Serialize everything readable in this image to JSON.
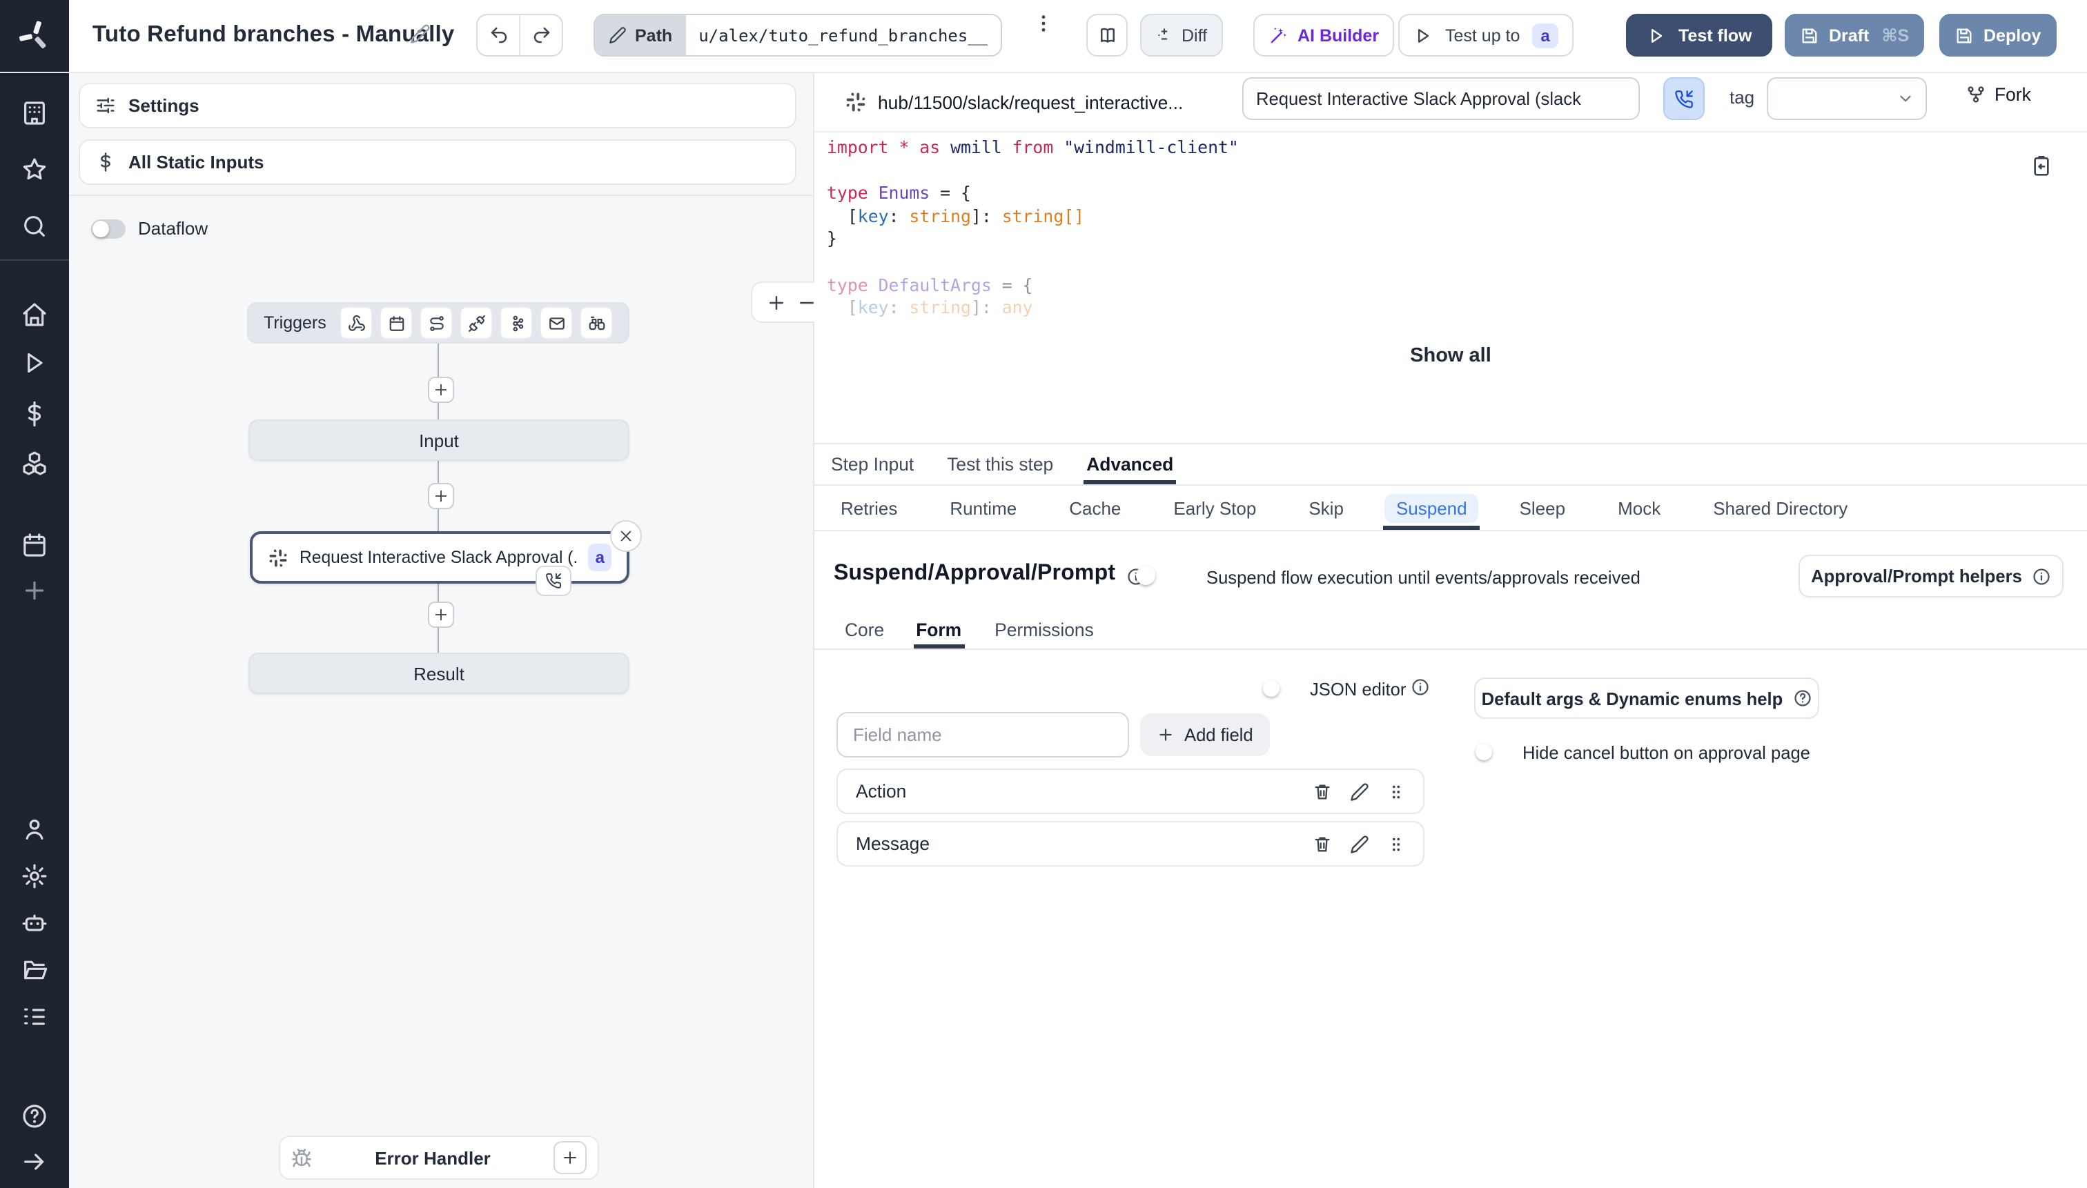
{
  "topbar": {
    "title": "Tuto Refund branches - Manually",
    "path_label": "Path",
    "path_value": "u/alex/tuto_refund_branches__",
    "diff_label": "Diff",
    "ai_builder_label": "AI Builder",
    "test_up_to_label": "Test up to",
    "test_up_to_badge": "a",
    "test_flow_label": "Test flow",
    "draft_label": "Draft",
    "draft_shortcut": "⌘S",
    "deploy_label": "Deploy"
  },
  "left_panel": {
    "settings_label": "Settings",
    "static_inputs_label": "All Static Inputs",
    "dataflow_label": "Dataflow"
  },
  "graph": {
    "triggers_label": "Triggers",
    "input_label": "Input",
    "step_label": "Request Interactive Slack Approval (...",
    "step_badge": "a",
    "result_label": "Result",
    "error_handler_label": "Error Handler"
  },
  "step": {
    "hub_path": "hub/11500/slack/request_interactive...",
    "summary_value": "Request Interactive Slack Approval (slack",
    "tag_label": "tag",
    "fork_label": "Fork",
    "show_all": "Show all",
    "main_tabs": [
      "Step Input",
      "Test this step",
      "Advanced"
    ],
    "advanced_tabs": [
      "Retries",
      "Runtime",
      "Cache",
      "Early Stop",
      "Skip",
      "Suspend",
      "Sleep",
      "Mock",
      "Shared Directory"
    ],
    "suspend": {
      "heading": "Suspend/Approval/Prompt",
      "toggle_label": "Suspend flow execution until events/approvals received",
      "helpers_label": "Approval/Prompt helpers",
      "form_tabs": [
        "Core",
        "Form",
        "Permissions"
      ],
      "json_editor_label": "JSON editor",
      "default_args_label": "Default args & Dynamic enums help",
      "hide_cancel_label": "Hide cancel button on approval page",
      "field_name_placeholder": "Field name",
      "add_field_label": "Add field",
      "fields": [
        {
          "name": "Action"
        },
        {
          "name": "Message"
        }
      ]
    }
  },
  "code": {
    "lines": [
      {
        "cls": "",
        "tokens": [
          {
            "t": "import ",
            "c": "kw"
          },
          {
            "t": "* ",
            "c": "kw"
          },
          {
            "t": "as ",
            "c": "kw"
          },
          {
            "t": "wmill ",
            "c": "id"
          },
          {
            "t": "from ",
            "c": "kw"
          },
          {
            "t": "\"windmill-client\"",
            "c": "str"
          }
        ]
      },
      {
        "cls": "",
        "tokens": []
      },
      {
        "cls": "",
        "tokens": [
          {
            "t": "type ",
            "c": "kw"
          },
          {
            "t": "Enums ",
            "c": "type"
          },
          {
            "t": "= {",
            "c": "pl"
          }
        ]
      },
      {
        "cls": "",
        "tokens": [
          {
            "t": "  [",
            "c": "pl"
          },
          {
            "t": "key",
            "c": "var"
          },
          {
            "t": ": ",
            "c": "pl"
          },
          {
            "t": "string",
            "c": "orange"
          },
          {
            "t": "]: ",
            "c": "pl"
          },
          {
            "t": "string[]",
            "c": "orange"
          }
        ]
      },
      {
        "cls": "",
        "tokens": [
          {
            "t": "}",
            "c": "pl"
          }
        ]
      },
      {
        "cls": "",
        "tokens": []
      },
      {
        "cls": "faded",
        "tokens": [
          {
            "t": "type ",
            "c": "kw"
          },
          {
            "t": "DefaultArgs ",
            "c": "type"
          },
          {
            "t": "= {",
            "c": "pl"
          }
        ]
      },
      {
        "cls": "faded2",
        "tokens": [
          {
            "t": "  [",
            "c": "pl"
          },
          {
            "t": "key",
            "c": "var"
          },
          {
            "t": ": ",
            "c": "pl"
          },
          {
            "t": "string",
            "c": "orange"
          },
          {
            "t": "]: ",
            "c": "pl"
          },
          {
            "t": "any",
            "c": "orange"
          }
        ]
      }
    ]
  },
  "colors": {
    "accent_blue": "#3b82f6",
    "navy_button": "#3d4e71",
    "slate_button": "#6d87ac",
    "badge_bg": "#e0e7ff",
    "badge_text": "#4338ca",
    "ai_purple": "#6d28d9",
    "sidebar_bg": "#1d2430"
  },
  "icons": {
    "logo": "windmill-pinwheel",
    "edit": "pencil",
    "undo": "↩",
    "redo": "↪",
    "more": "⋮",
    "docs": "book-open",
    "diff": "±",
    "ai": "wand-sparkles",
    "run": "▷",
    "save": "floppy",
    "sidebar": [
      "workspace-building",
      "star",
      "search",
      "home",
      "runs-play",
      "variables-dollar",
      "resources-boxes",
      "schedules-calendar",
      "add-plus",
      "user",
      "settings-gear",
      "ai-bot",
      "folders",
      "audit-list",
      "help-circle",
      "expand-arrow"
    ],
    "triggers": [
      "webhook",
      "schedule-calendar",
      "http-route",
      "websocket-plug",
      "kafka-dots",
      "email-envelope",
      "scheduled-poll-binoculars"
    ],
    "step": [
      "slack",
      "close-x",
      "phone-incoming",
      "copy-clipboard",
      "fork-git",
      "chevron-down",
      "info-circle",
      "help-circle",
      "trash",
      "pencil",
      "grip-dots",
      "bug"
    ]
  }
}
